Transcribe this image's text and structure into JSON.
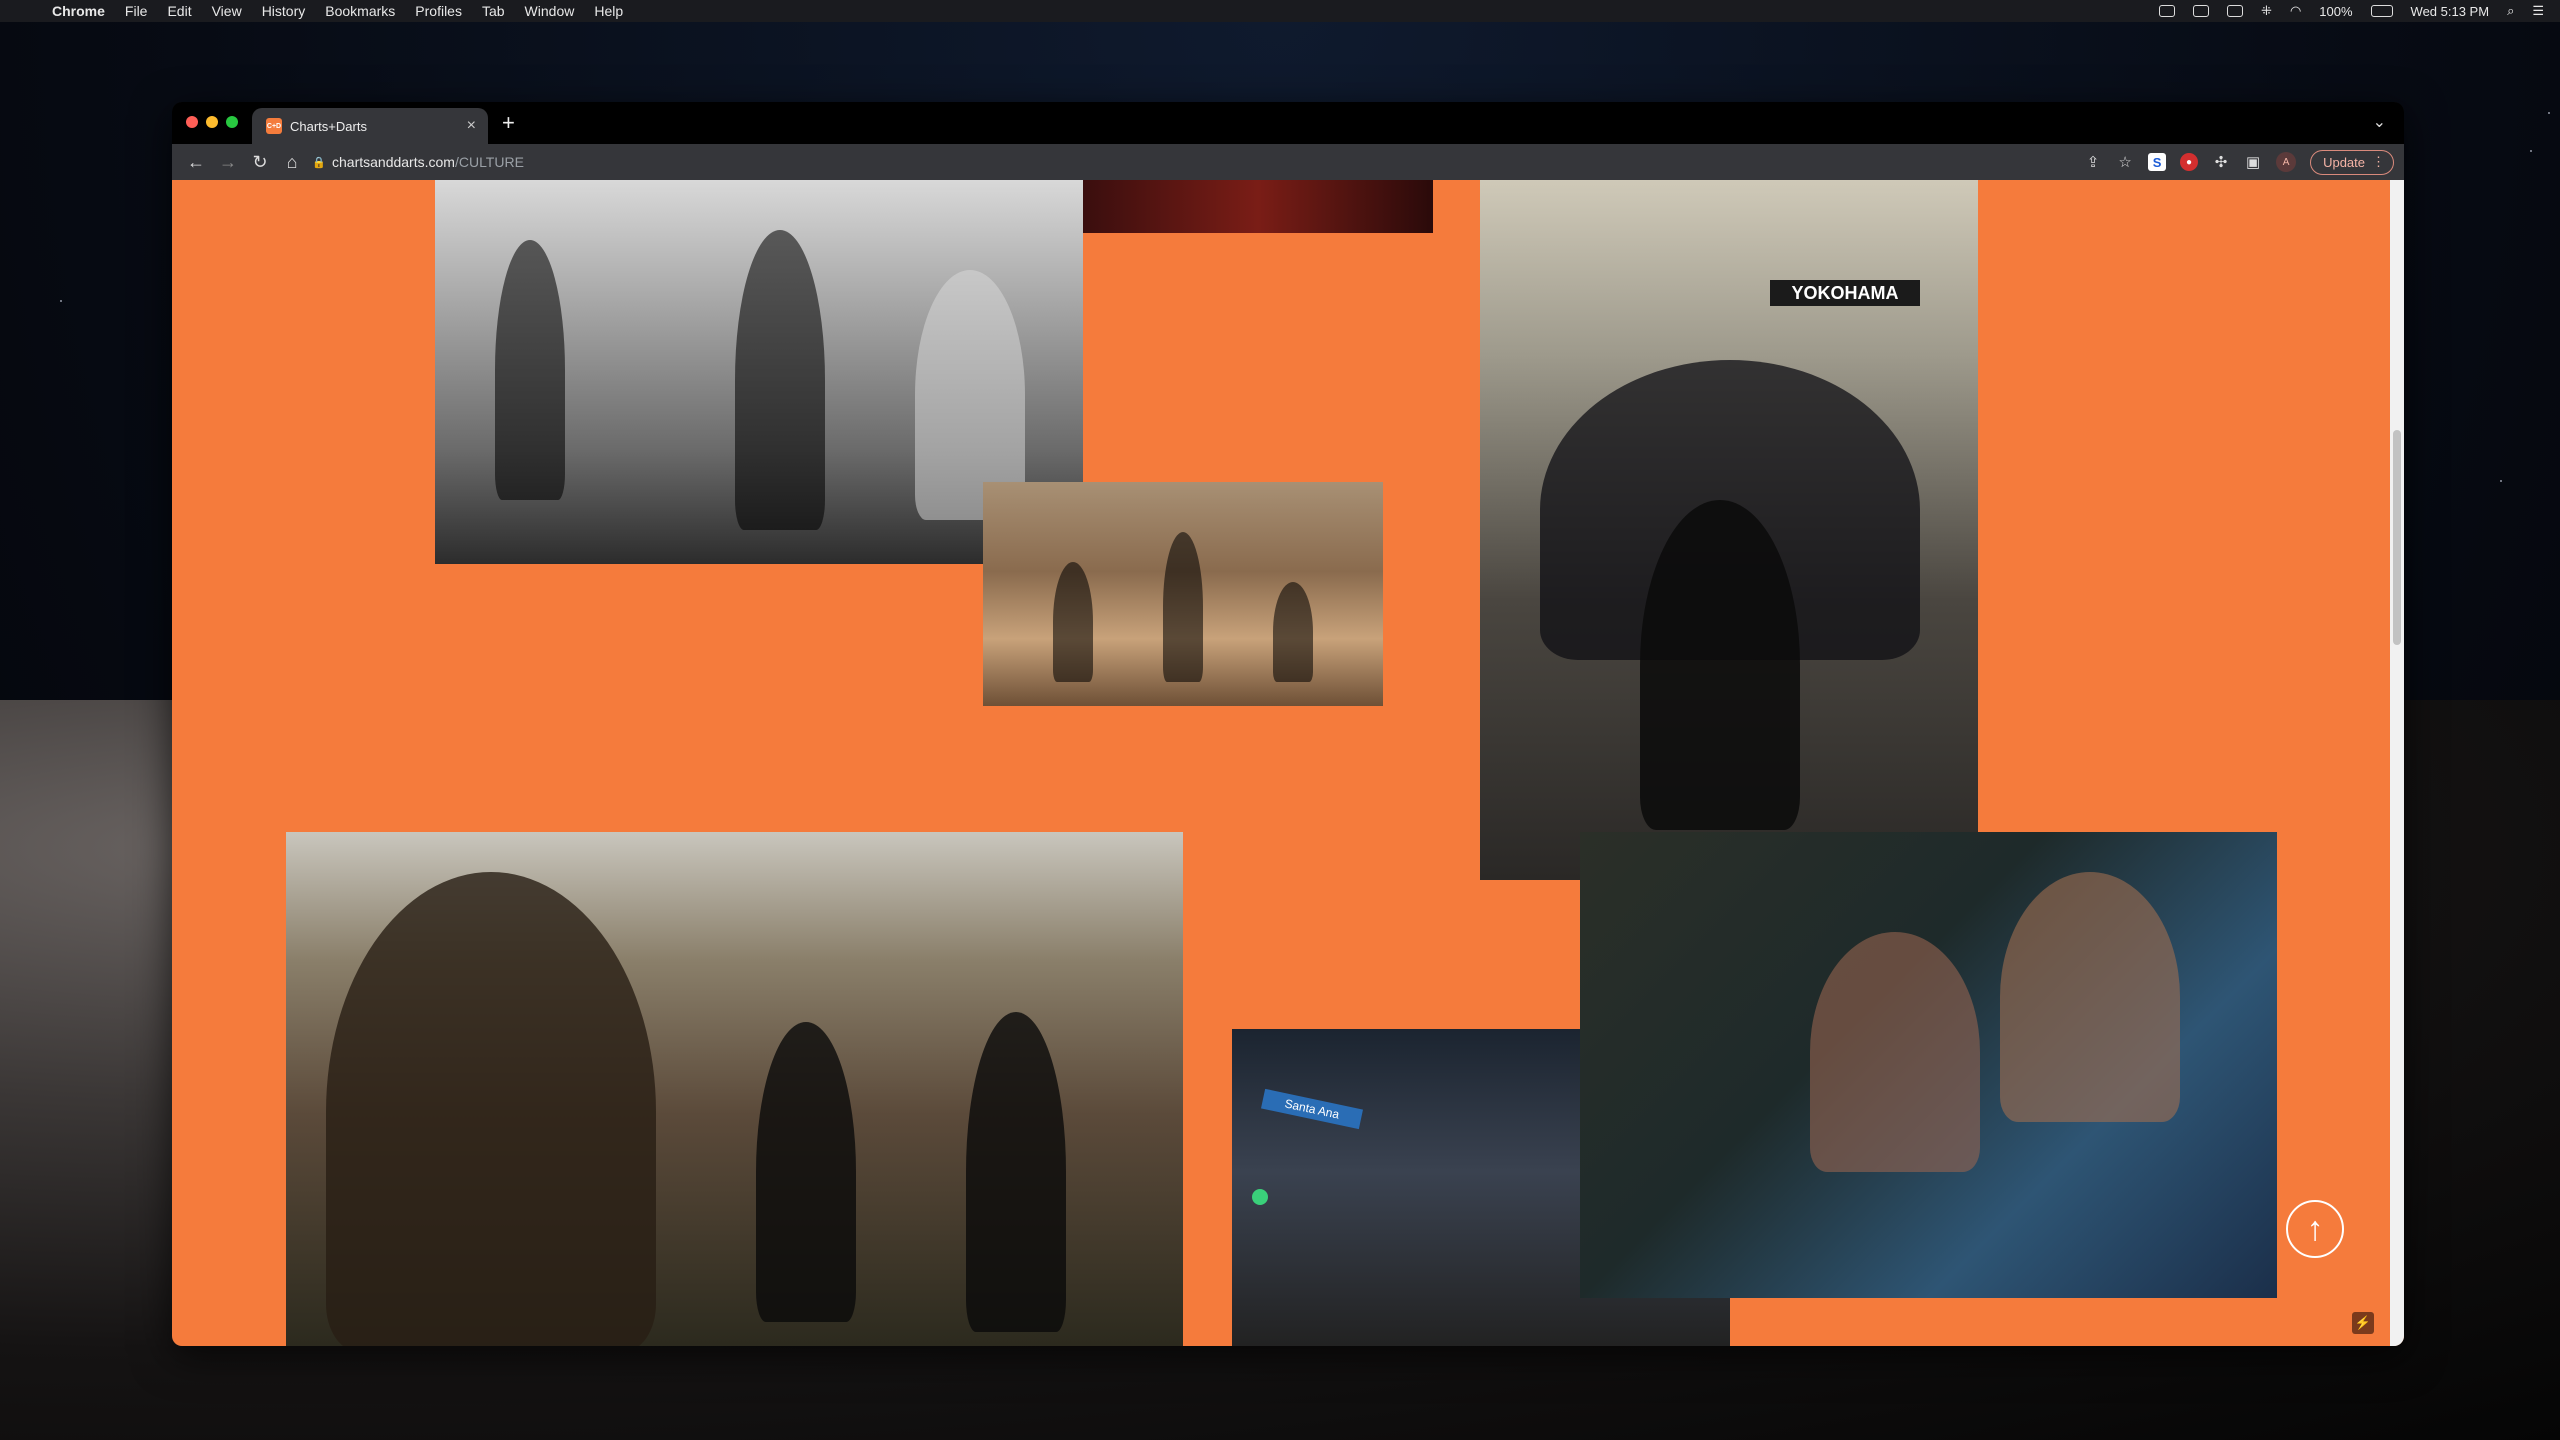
{
  "menubar": {
    "app": "Chrome",
    "items": [
      "File",
      "Edit",
      "View",
      "History",
      "Bookmarks",
      "Profiles",
      "Tab",
      "Window",
      "Help"
    ],
    "battery": "100%",
    "clock": "Wed 5:13 PM"
  },
  "browser": {
    "tab_title": "Charts+Darts",
    "favicon_text": "C+D",
    "url_host": "chartsanddarts.com",
    "url_path": "/CULTURE",
    "update_label": "Update",
    "profile_initial": "A",
    "ext_s": "S",
    "ext_r": "●"
  },
  "page": {
    "background": "#f57b3c",
    "scroll_to_top_icon": "arrow-up-icon",
    "scroll_to_top_glyph": "↑",
    "bolt_glyph": "⚡",
    "photos": [
      {
        "name": "photo-desert-crew-bw"
      },
      {
        "name": "photo-red-crop"
      },
      {
        "name": "photo-desert-rig"
      },
      {
        "name": "photo-pit-crew-yokohama"
      },
      {
        "name": "photo-motel-set-camera"
      },
      {
        "name": "photo-santa-ana-street"
      },
      {
        "name": "photo-friends-toast"
      }
    ],
    "pit_sign": "YOKOHAMA",
    "street_sign": "Santa Ana"
  }
}
